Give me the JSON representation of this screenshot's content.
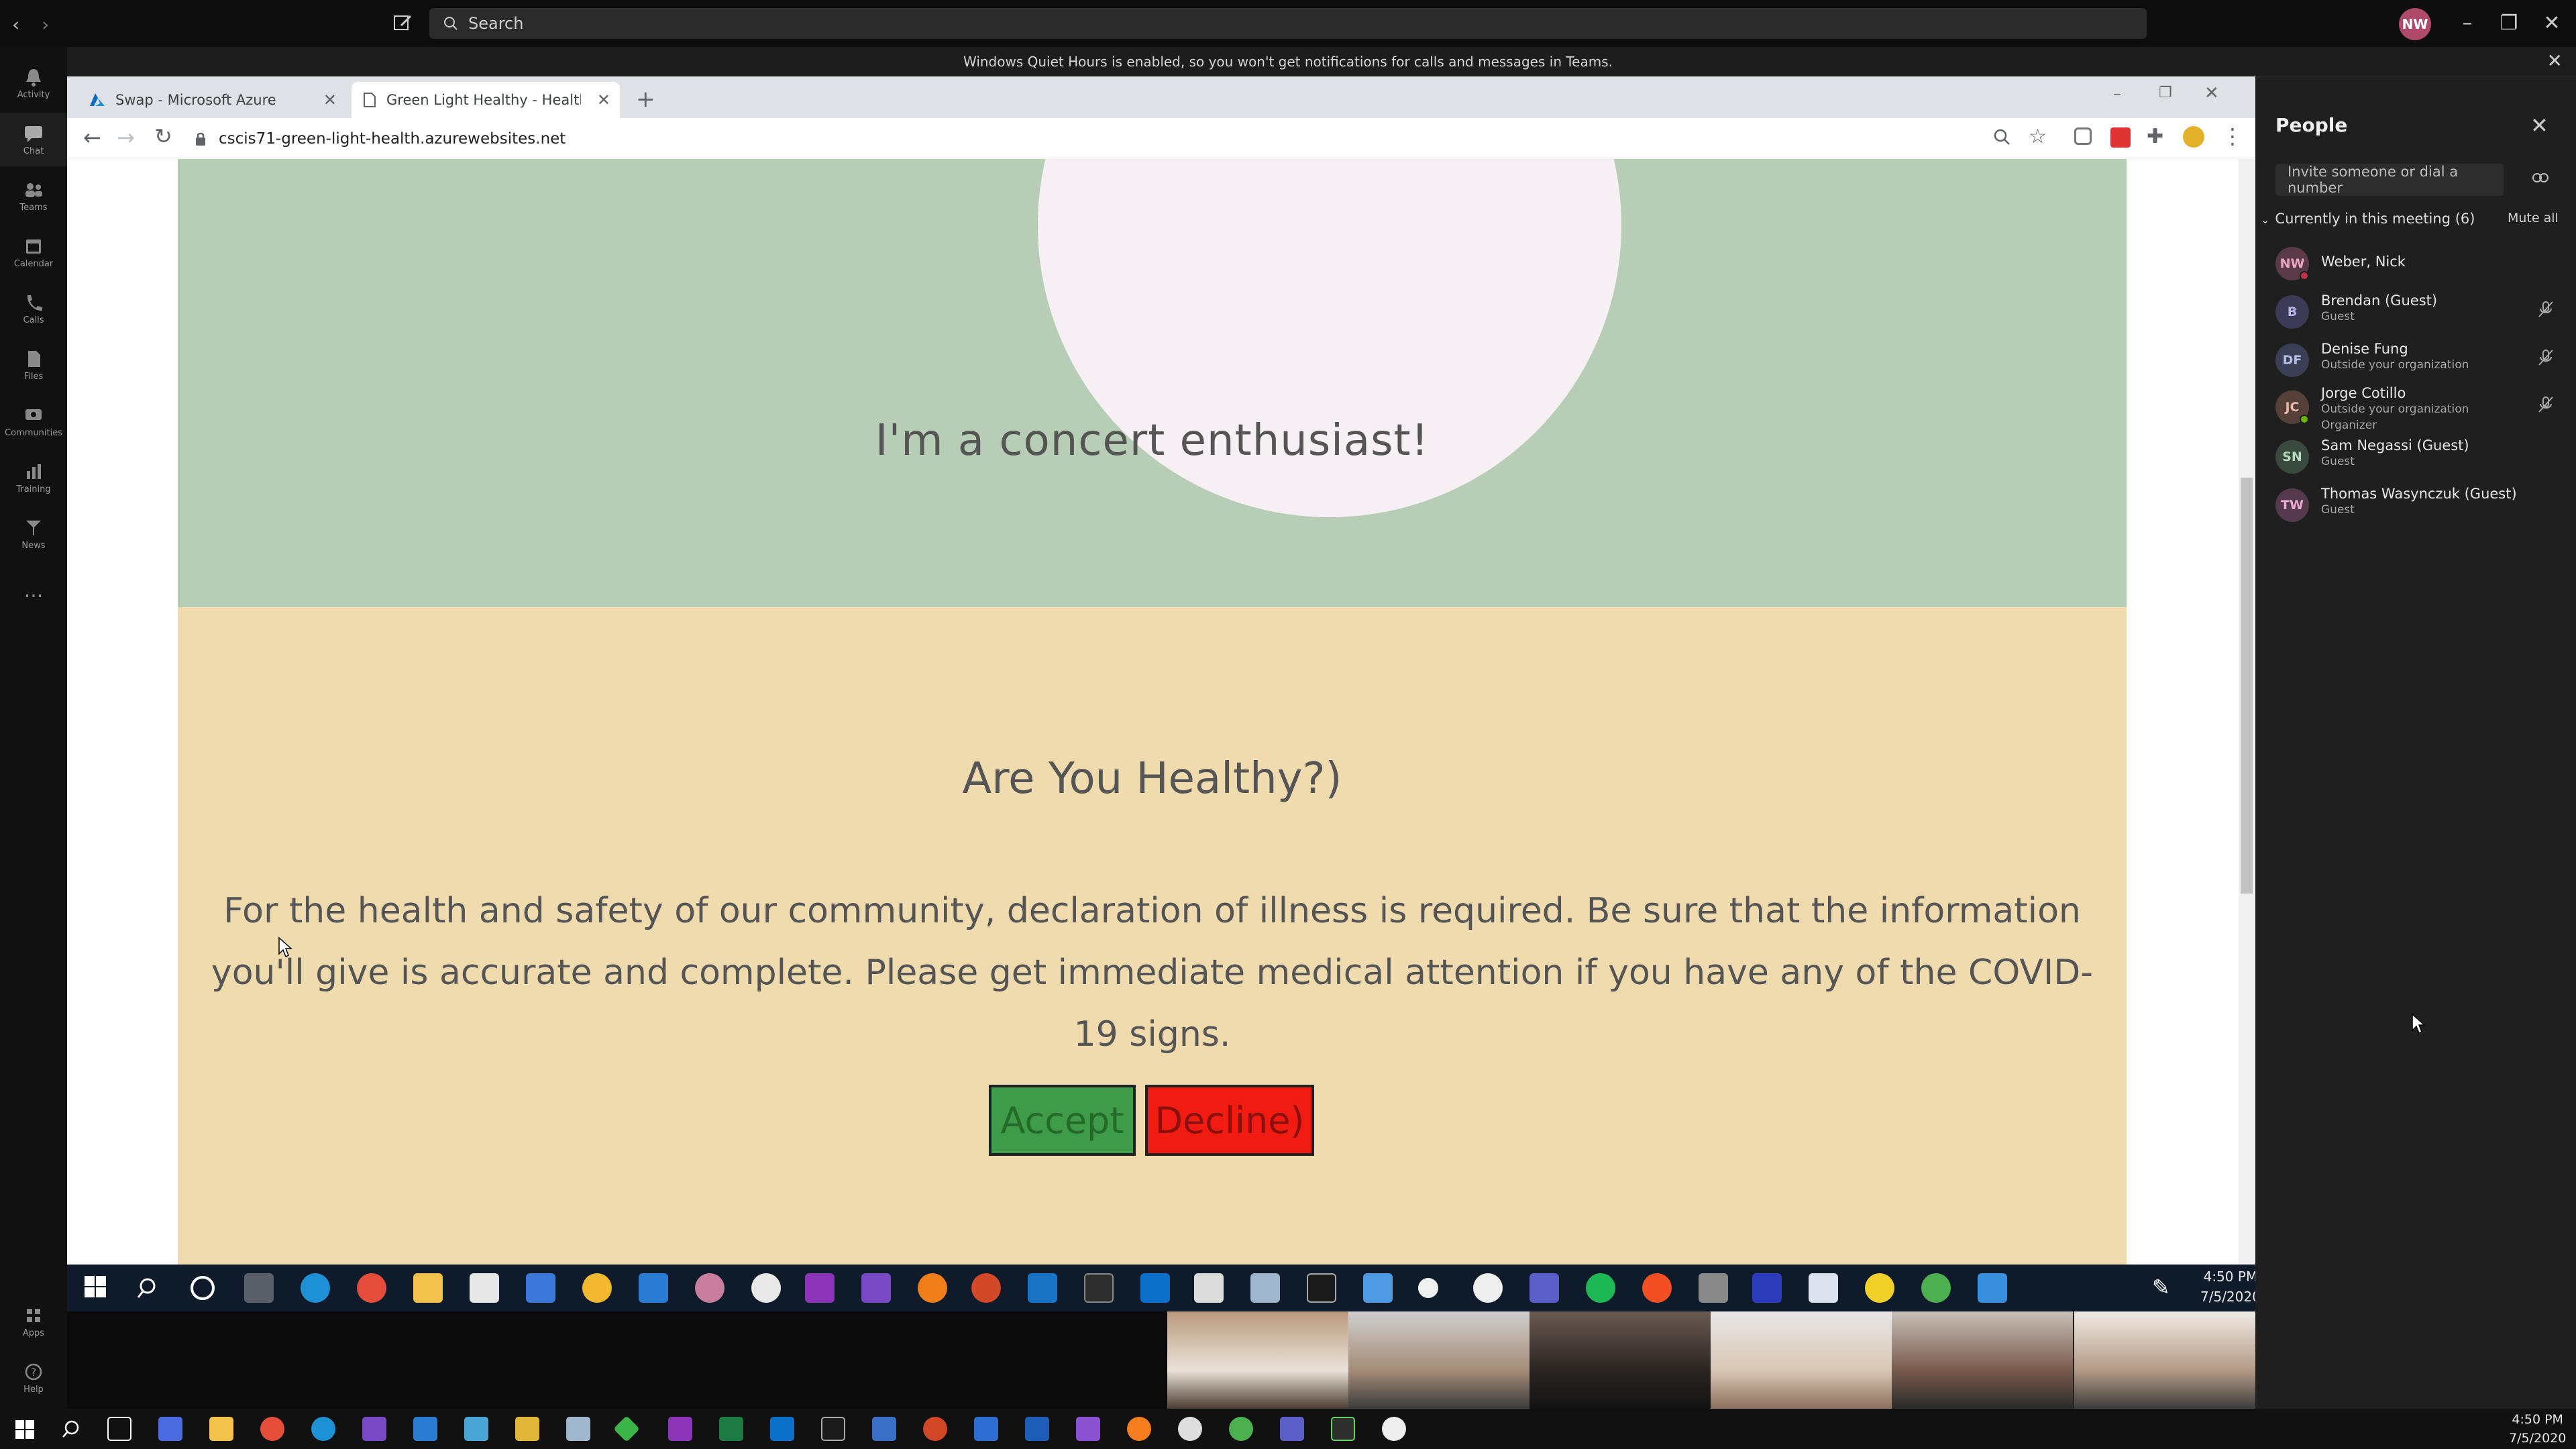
{
  "teams": {
    "search_placeholder": "Search",
    "avatar_initials": "NW",
    "banner": "Windows Quiet Hours is enabled, so you won't get notifications for calls and messages in Teams.",
    "rail": [
      {
        "label": "Activity",
        "icon": "bell-icon"
      },
      {
        "label": "Chat",
        "icon": "chat-icon"
      },
      {
        "label": "Teams",
        "icon": "teams-icon"
      },
      {
        "label": "Calendar",
        "icon": "calendar-icon"
      },
      {
        "label": "Calls",
        "icon": "phone-icon"
      },
      {
        "label": "Files",
        "icon": "file-icon"
      },
      {
        "label": "Communities",
        "icon": "communities-icon"
      },
      {
        "label": "Training",
        "icon": "chart-icon"
      },
      {
        "label": "News",
        "icon": "news-icon"
      },
      {
        "label": "...",
        "icon": "more-icon"
      },
      {
        "label": "Apps",
        "icon": "apps-icon"
      },
      {
        "label": "Help",
        "icon": "help-icon"
      }
    ]
  },
  "browser": {
    "tabs": [
      {
        "title": "Swap - Microsoft Azure",
        "icon": "azure-icon"
      },
      {
        "title": "Green Light Healthy - Health De",
        "icon": "page-icon"
      }
    ],
    "url": "cscis71-green-light-health.azurewebsites.net"
  },
  "page": {
    "profile_text": "I'm a concert enthusiast!",
    "heading": "Are You Healthy?)",
    "paragraph": "For the health and safety of our community, declaration of illness is required. Be sure that the information you'll give is accurate and complete. Please get immediate medical attention if you have any of the COVID-19 signs.",
    "accept_label": "Accept",
    "decline_label": "Decline)",
    "colors": {
      "green_section": "#b8cdb5",
      "tan_section": "#efdbae",
      "accept": "#3e9b4a",
      "decline": "#f01c12"
    }
  },
  "inner_taskbar": {
    "time": "4:50 PM",
    "date": "7/5/2020"
  },
  "people_panel": {
    "title": "People",
    "invite_placeholder": "Invite someone or dial a number",
    "section_header": "Currently in this meeting (6)",
    "mute_all": "Mute all",
    "people": [
      {
        "initials": "NW",
        "name": "Weber, Nick",
        "sub": "",
        "sub2": "",
        "avatar_color": "#5b3a48",
        "text_color": "#e9a8c0",
        "muted": false
      },
      {
        "initials": "B",
        "name": "Brendan (Guest)",
        "sub": "Guest",
        "sub2": "",
        "avatar_color": "#3c3a55",
        "text_color": "#b9b3ea",
        "muted": true
      },
      {
        "initials": "DF",
        "name": "Denise Fung",
        "sub": "Outside your organization",
        "sub2": "",
        "avatar_color": "#3a3f55",
        "text_color": "#b3bde8",
        "muted": true
      },
      {
        "initials": "JC",
        "name": "Jorge Cotillo",
        "sub": "Outside your organization",
        "sub2": "Organizer",
        "avatar_color": "#55403a",
        "text_color": "#e8b9a8",
        "muted": true
      },
      {
        "initials": "SN",
        "name": "Sam Negassi (Guest)",
        "sub": "Guest",
        "sub2": "",
        "avatar_color": "#3a4a3f",
        "text_color": "#b5dcbf",
        "muted": false
      },
      {
        "initials": "TW",
        "name": "Thomas Wasynczuk (Guest)",
        "sub": "Guest",
        "sub2": "",
        "avatar_color": "#553a4d",
        "text_color": "#e8a8d2",
        "muted": false
      }
    ]
  },
  "os_taskbar": {
    "time": "4:50 PM",
    "date": "7/5/2020"
  }
}
